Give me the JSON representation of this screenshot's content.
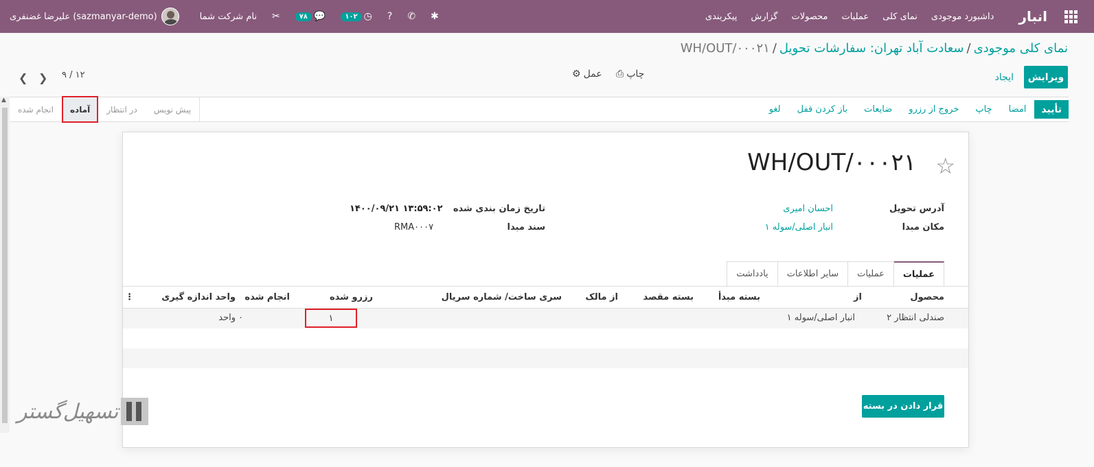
{
  "navbar": {
    "brand": "انبار",
    "menu": [
      "داشبورد موجودی",
      "نمای کلی",
      "عملیات",
      "محصولات",
      "گزارش",
      "پیکربندی"
    ],
    "user": "علیرضا غضنفری (sazmanyar-demo)",
    "company": "نام شرکت شما",
    "activity_count": "۱۰۲",
    "message_count": "۷۸"
  },
  "breadcrumb": {
    "items": [
      "نمای کلی موجودی",
      "سعادت آباد تهران: سفارشات تحویل"
    ],
    "current": "WH/OUT/۰۰۰۲۱"
  },
  "controlpanel": {
    "edit": "ویرایش",
    "create": "ایجاد",
    "print": "چاپ",
    "action": "عمل",
    "pager": "۹ / ۱۲"
  },
  "statusbar": {
    "buttons": [
      "تأیید",
      "امضا",
      "چاپ",
      "خروج از رزرو",
      "ضایعات",
      "باز کردن قفل",
      "لغو"
    ],
    "stages": [
      "پیش نویس",
      "در انتظار",
      "آماده",
      "انجام شده"
    ],
    "current_stage": "آماده"
  },
  "form": {
    "title": "WH/OUT/۰۰۰۲۱",
    "delivery_address_label": "آدرس تحویل",
    "delivery_address": "احسان امیری",
    "source_location_label": "مکان مبدا",
    "source_location": "انبار اصلی/سوله ۱",
    "scheduled_date_label": "تاریخ زمان بندی شده",
    "scheduled_date": "۱۴۰۰/۰۹/۲۱ ۱۳:۵۹:۰۲",
    "source_document_label": "سند مبدا",
    "source_document": "RMA۰۰۰۷"
  },
  "tabs": [
    "عملیات",
    "عملیات",
    "سایر اطلاعات",
    "یادداشت"
  ],
  "table": {
    "headers": [
      "محصول",
      "از",
      "بسته مبدأ",
      "بسته مقصد",
      "از مالک",
      "سری ساخت/ شماره سریال",
      "رزرو شده",
      "انجام شده",
      "واحد اندازه گیری"
    ],
    "rows": [
      {
        "product": "صندلی انتظار ۲",
        "from": "انبار اصلی/سوله ۱",
        "reserved": "۱",
        "done": "۰",
        "uom": "واحد"
      }
    ]
  },
  "put_in_pack": "قرار دادن در بسته",
  "watermark": "تسهیل‌گستر",
  "colors": {
    "brand": "#875a7b",
    "accent": "#00a09d",
    "highlight": "#e0202a"
  }
}
